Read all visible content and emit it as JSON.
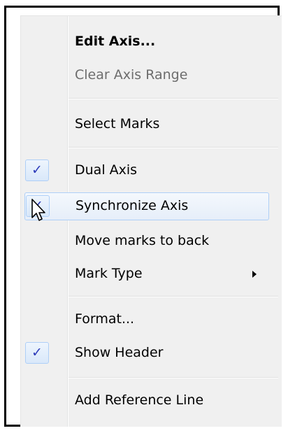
{
  "menu": {
    "items": [
      {
        "label": "Edit Axis..."
      },
      {
        "label": "Clear Axis Range"
      },
      {
        "label": "Select Marks"
      },
      {
        "label": "Dual Axis"
      },
      {
        "label": "Synchronize Axis"
      },
      {
        "label": "Move marks to back"
      },
      {
        "label": "Mark Type"
      },
      {
        "label": "Format..."
      },
      {
        "label": "Show Header"
      },
      {
        "label": "Add Reference Line"
      }
    ],
    "check_glyph": "✓"
  },
  "colors": {
    "menu_background": "#f0f0f0",
    "hover_border": "#aecff7",
    "check_color": "#2d3bba",
    "disabled_text": "#6d6d6d"
  },
  "icons": {
    "submenu": "chevron-right-icon",
    "cursor": "mouse-pointer-icon",
    "check": "checkmark-icon"
  }
}
